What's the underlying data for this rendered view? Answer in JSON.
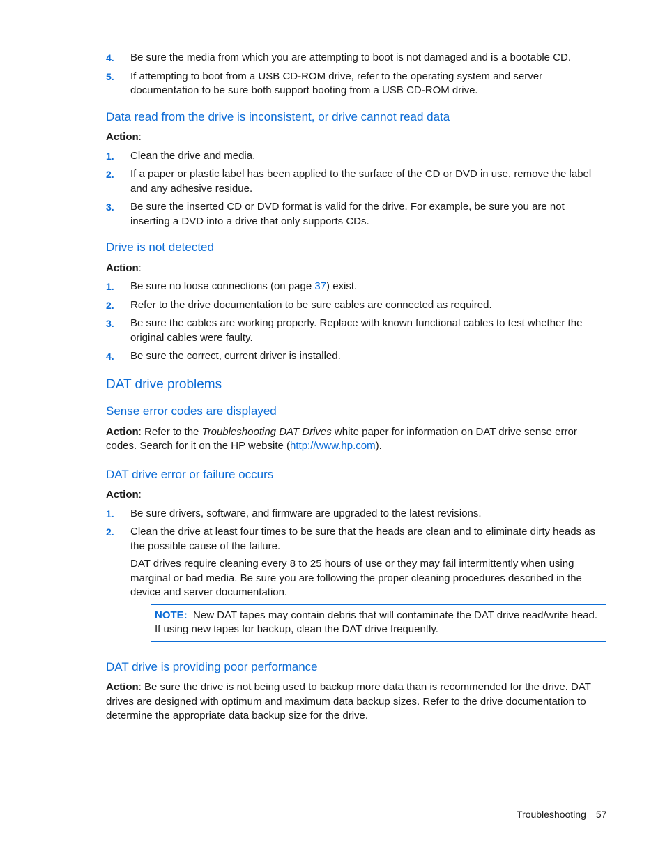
{
  "top_list": [
    {
      "num": "4.",
      "text": "Be sure the media from which you are attempting to boot is not damaged and is a bootable CD."
    },
    {
      "num": "5.",
      "text": "If attempting to boot from a USB CD-ROM drive, refer to the operating system and server documentation to be sure both support booting from a USB CD-ROM drive."
    }
  ],
  "section_inconsistent": {
    "heading": "Data read from the drive is inconsistent, or drive cannot read data",
    "action_label": "Action",
    "items": [
      {
        "num": "1.",
        "text": "Clean the drive and media."
      },
      {
        "num": "2.",
        "text": "If a paper or plastic label has been applied to the surface of the CD or DVD in use, remove the label and any adhesive residue."
      },
      {
        "num": "3.",
        "text": "Be sure the inserted CD or DVD format is valid for the drive. For example, be sure you are not inserting a DVD into a drive that only supports CDs."
      }
    ]
  },
  "section_not_detected": {
    "heading": "Drive is not detected",
    "action_label": "Action",
    "item1_pre": "Be sure no loose connections (on page ",
    "item1_link": "37",
    "item1_post": ") exist.",
    "items": [
      {
        "num": "1.",
        "text": ""
      },
      {
        "num": "2.",
        "text": "Refer to the drive documentation to be sure cables are connected as required."
      },
      {
        "num": "3.",
        "text": "Be sure the cables are working properly. Replace with known functional cables to test whether the original cables were faulty."
      },
      {
        "num": "4.",
        "text": "Be sure the correct, current driver is installed."
      }
    ]
  },
  "dat_heading": "DAT drive problems",
  "section_sense": {
    "heading": "Sense error codes are displayed",
    "action_label": "Action",
    "text_pre": ": Refer to the ",
    "text_italic": "Troubleshooting DAT Drives",
    "text_mid": " white paper for information on DAT drive sense error codes. Search for it on the HP website (",
    "link": "http://www.hp.com",
    "text_post": ")."
  },
  "section_failure": {
    "heading": "DAT drive error or failure occurs",
    "action_label": "Action",
    "items": [
      {
        "num": "1.",
        "text": "Be sure drivers, software, and firmware are upgraded to the latest revisions."
      },
      {
        "num": "2.",
        "text": "Clean the drive at least four times to be sure that the heads are clean and to eliminate dirty heads as the possible cause of the failure."
      }
    ],
    "extra_para": "DAT drives require cleaning every 8 to 25 hours of use or they may fail intermittently when using marginal or bad media. Be sure you are following the proper cleaning procedures described in the device and server documentation.",
    "note_label": "NOTE:",
    "note_text": "New DAT tapes may contain debris that will contaminate the DAT drive read/write head. If using new tapes for backup, clean the DAT drive frequently."
  },
  "section_performance": {
    "heading": "DAT drive is providing poor performance",
    "action_label": "Action",
    "text": ": Be sure the drive is not being used to backup more data than is recommended for the drive. DAT drives are designed with optimum and maximum data backup sizes. Refer to the drive documentation to determine the appropriate data backup size for the drive."
  },
  "footer": {
    "section": "Troubleshooting",
    "page": "57"
  },
  "colors": {
    "accent": "#0c6cd6",
    "text": "#1a1a1a"
  }
}
